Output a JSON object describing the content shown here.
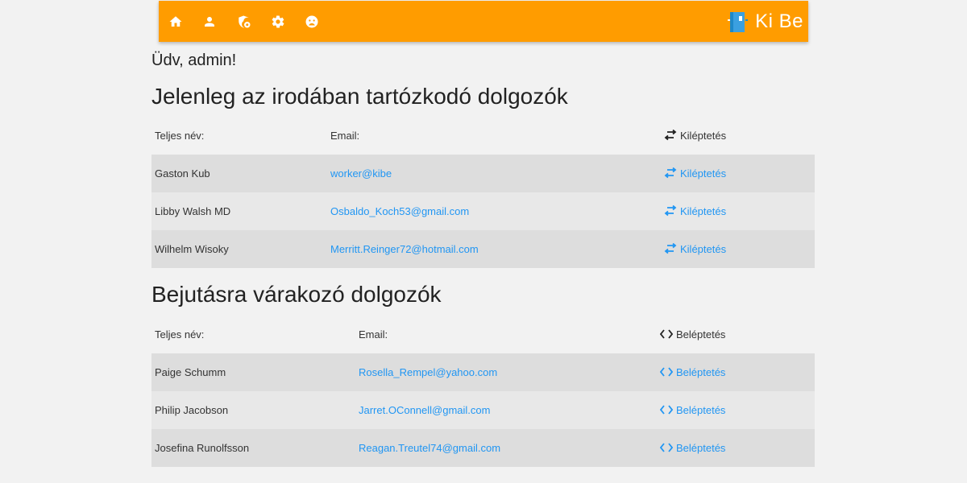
{
  "nav": {
    "icons": [
      "home-icon",
      "person-icon",
      "admin-shield-icon",
      "gear-icon",
      "sad-face-icon"
    ],
    "brand": "Ki Be",
    "brand_color": "#ff9c00"
  },
  "greeting": "Üdv, admin!",
  "present": {
    "title": "Jelenleg az irodában tartózkodó dolgozók",
    "headers": {
      "name": "Teljes név:",
      "email": "Email:",
      "action": "Kiléptetés"
    },
    "rows": [
      {
        "name": "Gaston Kub",
        "email": "worker@kibe",
        "action": "Kiléptetés"
      },
      {
        "name": "Libby Walsh MD",
        "email": "Osbaldo_Koch53@gmail.com",
        "action": "Kiléptetés"
      },
      {
        "name": "Wilhelm Wisoky",
        "email": "Merritt.Reinger72@hotmail.com",
        "action": "Kiléptetés"
      }
    ]
  },
  "waiting": {
    "title": "Bejutásra várakozó dolgozók",
    "headers": {
      "name": "Teljes név:",
      "email": "Email:",
      "action": "Beléptetés"
    },
    "rows": [
      {
        "name": "Paige Schumm",
        "email": "Rosella_Rempel@yahoo.com",
        "action": "Beléptetés"
      },
      {
        "name": "Philip Jacobson",
        "email": "Jarret.OConnell@gmail.com",
        "action": "Beléptetés"
      },
      {
        "name": "Josefina Runolfsson",
        "email": "Reagan.Treutel74@gmail.com",
        "action": "Beléptetés"
      }
    ]
  },
  "link_color": "#2196f3"
}
